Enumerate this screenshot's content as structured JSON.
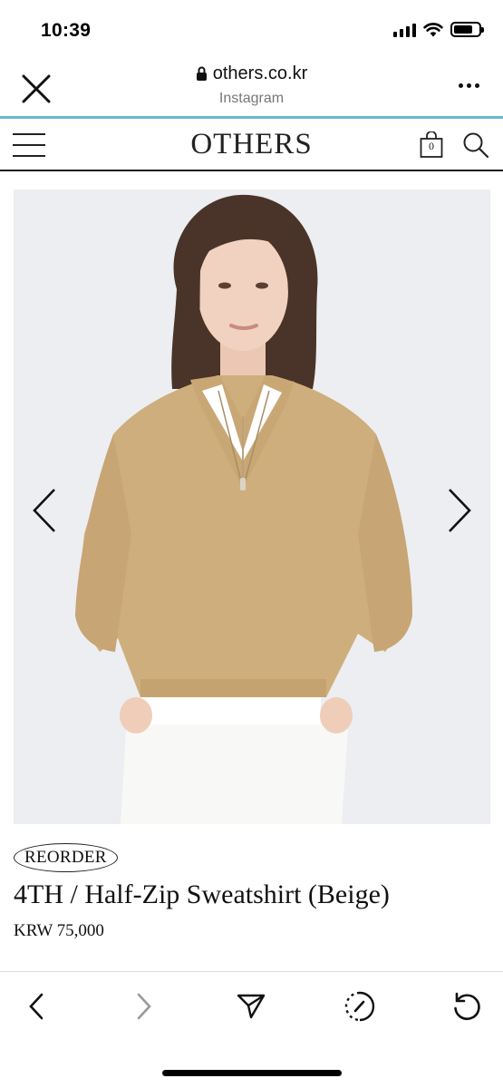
{
  "status_bar": {
    "time": "10:39",
    "signal_bars": 4,
    "battery_level": 0.75
  },
  "browser": {
    "url": "others.co.kr",
    "subtitle": "Instagram",
    "close_icon": "close-icon",
    "lock_icon": "lock-icon",
    "more_icon": "more-horizontal-icon",
    "accent_color": "#69b8d4"
  },
  "site_header": {
    "logo": "OTHERS",
    "menu_icon": "hamburger-menu-icon",
    "bag_count": "0",
    "bag_icon": "shopping-bag-icon",
    "search_icon": "search-icon"
  },
  "product": {
    "badge": "REORDER",
    "title": "4TH / Half-Zip Sweatshirt (Beige)",
    "price": "KRW 75,000",
    "image": "model-wearing-beige-half-zip-sweatshirt",
    "prev_icon": "chevron-left-icon",
    "next_icon": "chevron-right-icon"
  },
  "toolbar": {
    "items": [
      "back-icon",
      "forward-icon",
      "share-icon",
      "open-in-browser-icon",
      "reload-icon"
    ]
  }
}
